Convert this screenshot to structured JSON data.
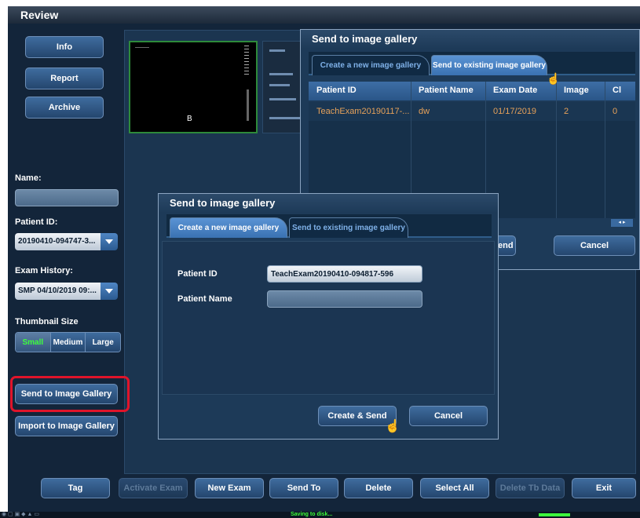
{
  "window": {
    "title": "Review"
  },
  "left_panel": {
    "info_button": "Info",
    "report_button": "Report",
    "archive_button": "Archive",
    "name_label": "Name:",
    "name_value": "",
    "patient_id_label": "Patient ID:",
    "patient_id_value": "20190410-094747-3...",
    "exam_history_label": "Exam History:",
    "exam_history_value": "SMP 04/10/2019 09:...",
    "thumbnail_size_label": "Thumbnail Size",
    "thumbnail_sizes": [
      "Small",
      "Medium",
      "Large"
    ],
    "thumbnail_selected": "Small",
    "send_to_gallery_button": "Send to Image Gallery",
    "import_to_gallery_button": "Import to Image Gallery"
  },
  "thumbnail": {
    "label": "B"
  },
  "bottom_bar": {
    "tag": "Tag",
    "activate_exam": "Activate Exam",
    "new_exam": "New Exam",
    "send_to": "Send To",
    "delete": "Delete",
    "select_all": "Select All",
    "delete_tb_data": "Delete Tb Data",
    "exit": "Exit"
  },
  "status_bar": {
    "message": "Saving to disk..."
  },
  "dialog_back": {
    "title": "Send to image gallery",
    "tabs": [
      "Create a new image gallery",
      "Send to existing image gallery"
    ],
    "active_tab": "Send to existing image gallery",
    "columns": [
      "Patient ID",
      "Patient Name",
      "Exam Date",
      "Image",
      "Cl"
    ],
    "rows": [
      [
        "TeachExam20190117-...",
        "dw",
        "01/17/2019",
        "2",
        "0"
      ]
    ],
    "send_button": "end",
    "cancel_button": "Cancel",
    "scroll_arrows": "◂ ▸"
  },
  "dialog_front": {
    "title": "Send to image gallery",
    "tabs": [
      "Create a new image gallery",
      "Send to existing image gallery"
    ],
    "active_tab": "Create a new image gallery",
    "patient_id_label": "Patient ID",
    "patient_id_value": "TeachExam20190410-094817-596",
    "patient_name_label": "Patient Name",
    "patient_name_value": "",
    "create_send_button": "Create & Send",
    "cancel_button": "Cancel"
  },
  "colors": {
    "background": "#13253a",
    "accent": "#3a72b2",
    "highlight": "#e0142a",
    "selected_text": "#3dff3d",
    "row_text": "#e6a15a"
  },
  "icons": [
    "hand-pointer-icon",
    "dropdown-arrow-icon",
    "status-tray-icons"
  ]
}
